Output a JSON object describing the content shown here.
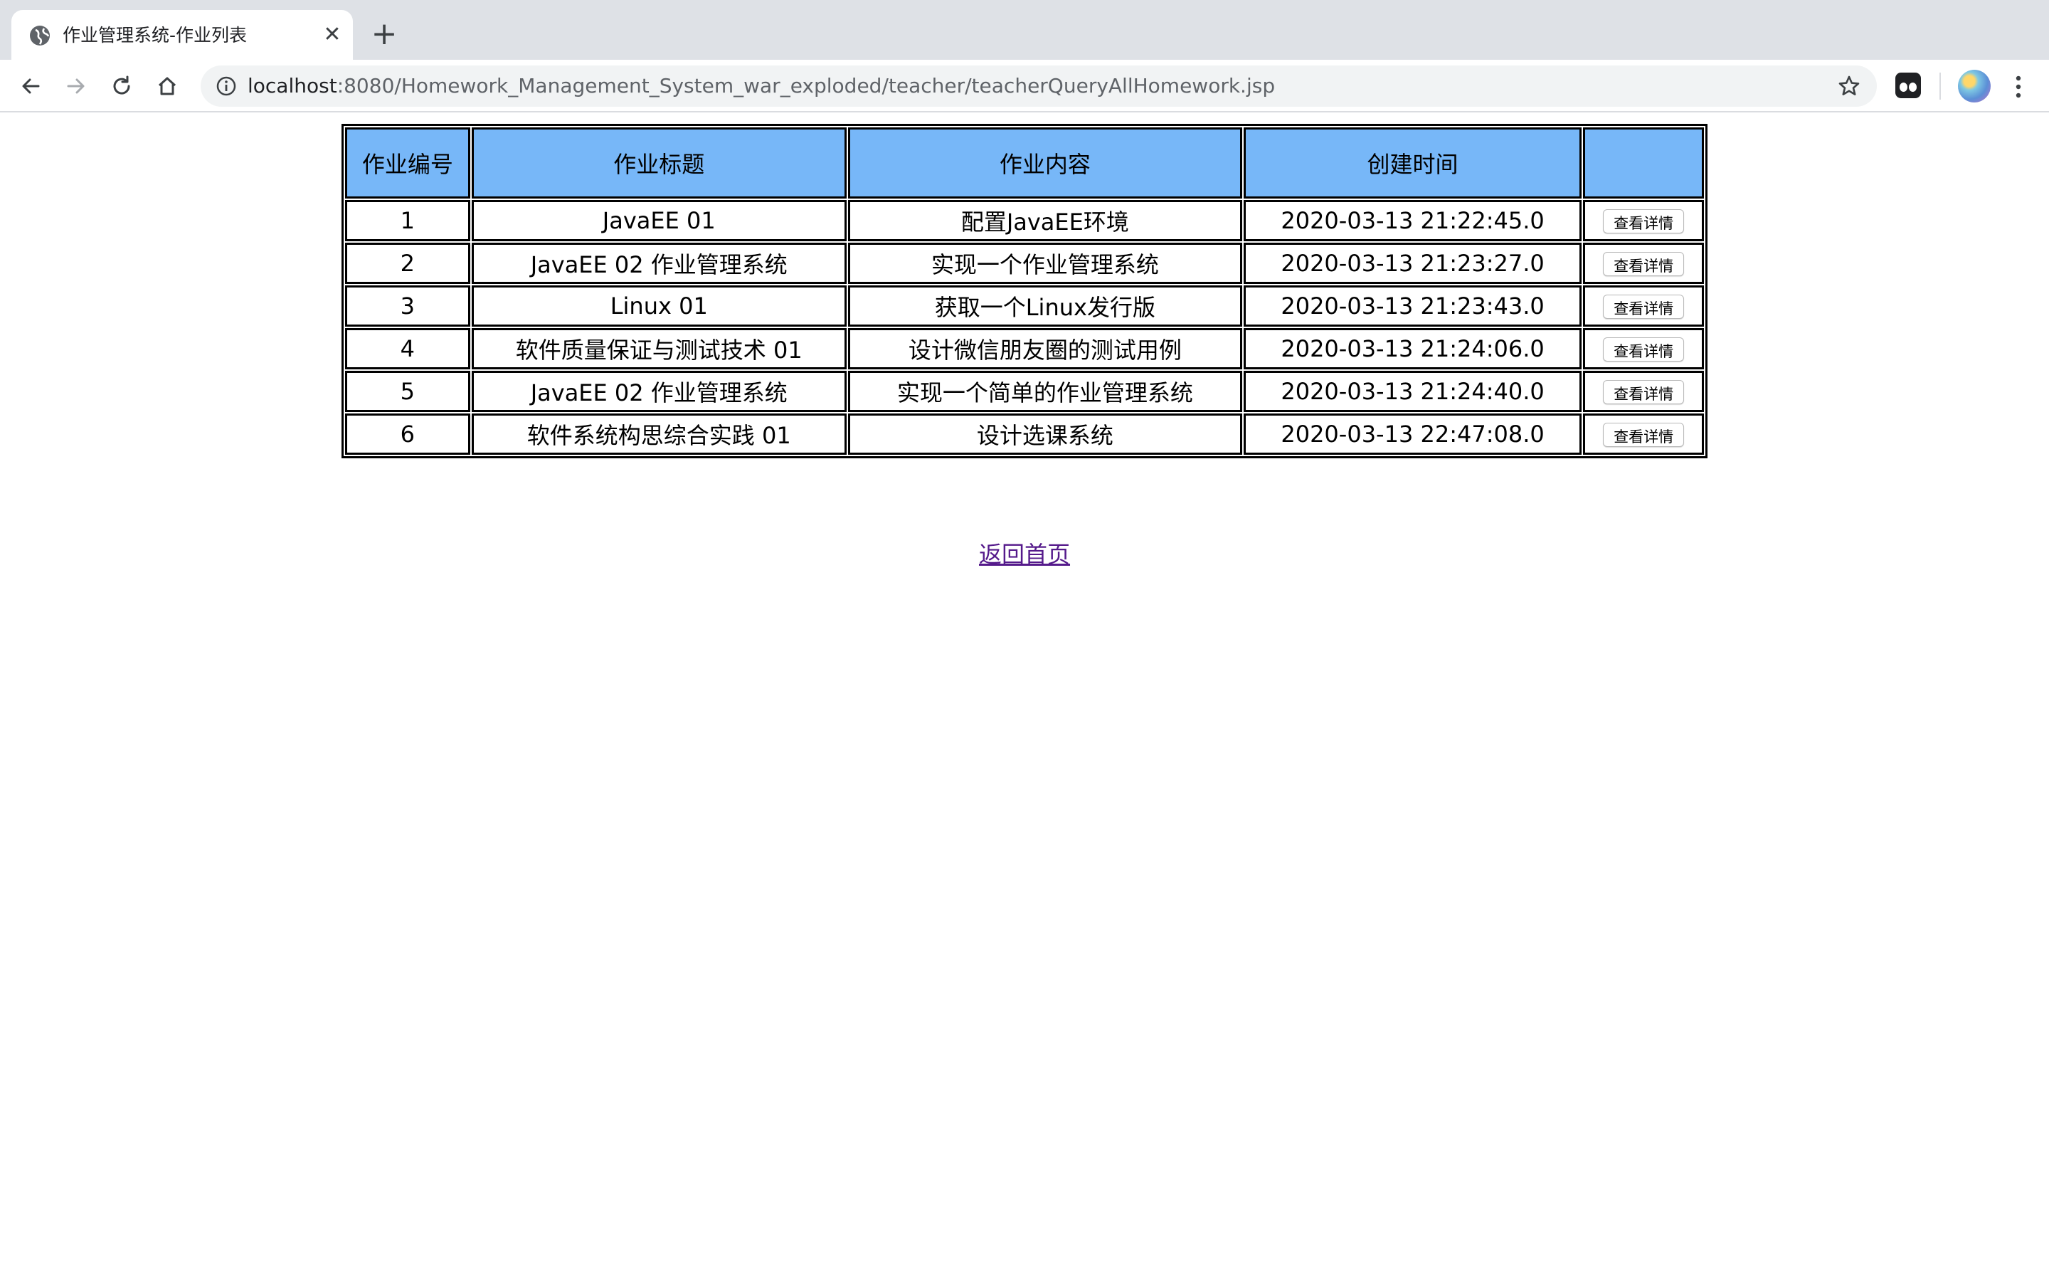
{
  "browser": {
    "tab_title": "作业管理系统-作业列表",
    "tab_close": "✕",
    "new_tab": "+",
    "url_host": "localhost",
    "url_rest": ":8080/Homework_Management_System_war_exploded/teacher/teacherQueryAllHomework.jsp",
    "icons": [
      "back-icon",
      "forward-icon",
      "reload-icon",
      "home-icon",
      "info-icon",
      "star-icon",
      "extension-icon",
      "avatar",
      "menu-icon"
    ]
  },
  "table": {
    "headers": [
      "作业编号",
      "作业标题",
      "作业内容",
      "创建时间",
      ""
    ],
    "header_bg": "#77b7f8",
    "button_label": "查看详情",
    "rows": [
      {
        "id": "1",
        "title": "JavaEE 01",
        "content": "配置JavaEE环境",
        "created": "2020-03-13 21:22:45.0"
      },
      {
        "id": "2",
        "title": "JavaEE 02 作业管理系统",
        "content": "实现一个作业管理系统",
        "created": "2020-03-13 21:23:27.0"
      },
      {
        "id": "3",
        "title": "Linux 01",
        "content": "获取一个Linux发行版",
        "created": "2020-03-13 21:23:43.0"
      },
      {
        "id": "4",
        "title": "软件质量保证与测试技术 01",
        "content": "设计微信朋友圈的测试用例",
        "created": "2020-03-13 21:24:06.0"
      },
      {
        "id": "5",
        "title": "JavaEE 02 作业管理系统",
        "content": "实现一个简单的作业管理系统",
        "created": "2020-03-13 21:24:40.0"
      },
      {
        "id": "6",
        "title": "软件系统构思综合实践 01",
        "content": "设计选课系统",
        "created": "2020-03-13 22:47:08.0"
      }
    ]
  },
  "footer": {
    "home_link": "返回首页",
    "link_color": "#551a8b"
  }
}
